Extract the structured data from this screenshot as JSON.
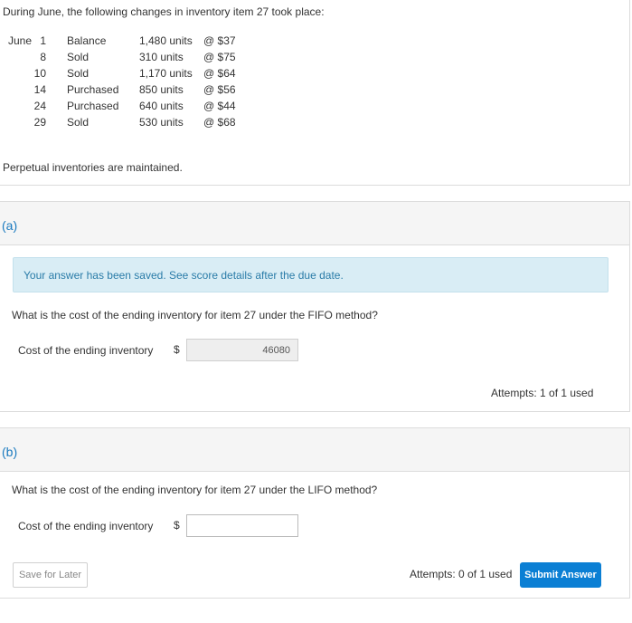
{
  "problem": {
    "intro": "During June, the following changes in inventory item 27 took place:",
    "rows": [
      {
        "month": "June",
        "day": "1",
        "type": "Balance",
        "units": "1,480 units",
        "price": "@ $37"
      },
      {
        "month": "",
        "day": "8",
        "type": "Sold",
        "units": "310 units",
        "price": "@ $75"
      },
      {
        "month": "",
        "day": "10",
        "type": "Sold",
        "units": "1,170 units",
        "price": "@ $64"
      },
      {
        "month": "",
        "day": "14",
        "type": "Purchased",
        "units": "850 units",
        "price": "@ $56"
      },
      {
        "month": "",
        "day": "24",
        "type": "Purchased",
        "units": "640 units",
        "price": "@ $44"
      },
      {
        "month": "",
        "day": "29",
        "type": "Sold",
        "units": "530 units",
        "price": "@ $68"
      }
    ],
    "note": "Perpetual inventories are maintained."
  },
  "part_a": {
    "label": "(a)",
    "saved_message": "Your answer has been saved. See score details after the due date.",
    "question": "What is the cost of the ending inventory for item 27 under the FIFO method?",
    "field_label": "Cost of the ending inventory",
    "currency": "$",
    "answer": "46080",
    "attempts": "Attempts: 1 of 1 used"
  },
  "part_b": {
    "label": "(b)",
    "question": "What is the cost of the ending inventory for item 27 under the LIFO method?",
    "field_label": "Cost of the ending inventory",
    "currency": "$",
    "answer": "",
    "save_label": "Save for Later",
    "attempts": "Attempts: 0 of 1 used",
    "submit_label": "Submit Answer"
  }
}
